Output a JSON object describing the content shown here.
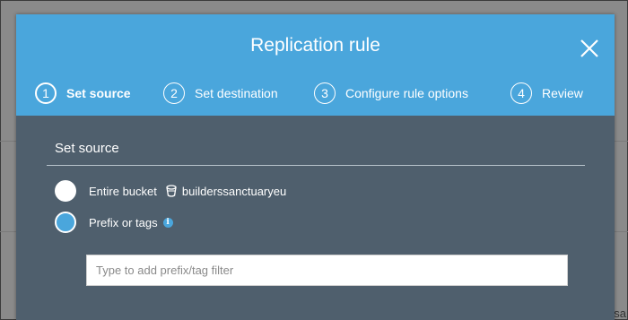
{
  "modal": {
    "title": "Replication rule",
    "close_icon": "close-icon"
  },
  "steps": [
    {
      "number": "1",
      "label": "Set source",
      "active": true
    },
    {
      "number": "2",
      "label": "Set destination",
      "active": false
    },
    {
      "number": "3",
      "label": "Configure rule options",
      "active": false
    },
    {
      "number": "4",
      "label": "Review",
      "active": false
    }
  ],
  "section": {
    "title": "Set source"
  },
  "options": {
    "entire_bucket": {
      "label": "Entire bucket",
      "bucket_name": "builderssanctuaryeu",
      "icon": "bucket-icon",
      "selected": false
    },
    "prefix_or_tags": {
      "label": "Prefix or tags",
      "icon": "info-icon",
      "selected": true
    }
  },
  "filter_input": {
    "placeholder": "Type to add prefix/tag filter",
    "value": ""
  },
  "background": {
    "partial_text": "sa"
  },
  "colors": {
    "header_blue": "#4aa6dc",
    "body_slate": "#4f5f6d",
    "radio_selected": "#4aa6dc"
  }
}
